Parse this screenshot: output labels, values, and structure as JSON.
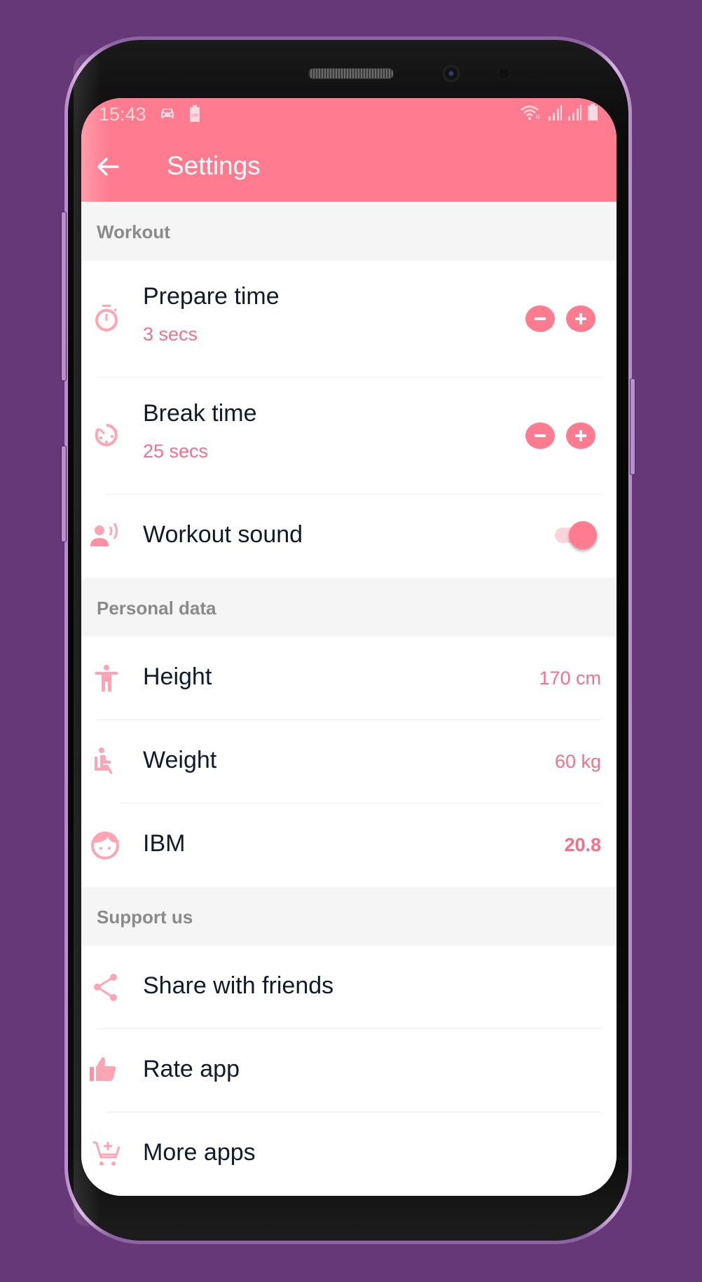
{
  "status_bar": {
    "time": "15:43",
    "left_icons": [
      "car-icon",
      "battery-100-icon"
    ],
    "right_icons": [
      "wifi-icon",
      "signal-icon",
      "signal-icon",
      "battery-icon"
    ]
  },
  "app_bar": {
    "back_icon": "arrow-left-icon",
    "title": "Settings"
  },
  "colors": {
    "accent": "#ff7b8f",
    "accent_text": "#f56f89",
    "primary_text": "#0f1b2d",
    "section_text": "#8a8a8a",
    "section_bg": "#f5f5f5",
    "background": "#663877"
  },
  "sections": [
    {
      "title": "Workout",
      "items": [
        {
          "icon": "stopwatch-icon",
          "label": "Prepare time",
          "value": "3 secs",
          "control": "stepper"
        },
        {
          "icon": "timer-icon",
          "label": "Break time",
          "value": "25 secs",
          "control": "stepper"
        },
        {
          "icon": "voice-icon",
          "label": "Workout sound",
          "control": "toggle",
          "toggle_on": true
        }
      ]
    },
    {
      "title": "Personal data",
      "items": [
        {
          "icon": "person-height-icon",
          "label": "Height",
          "value": "170 cm"
        },
        {
          "icon": "seated-person-icon",
          "label": "Weight",
          "value": "60 kg"
        },
        {
          "icon": "face-icon",
          "label": "IBM",
          "value": "20.8"
        }
      ]
    },
    {
      "title": "Support us",
      "items": [
        {
          "icon": "share-icon",
          "label": "Share with friends"
        },
        {
          "icon": "thumbs-up-icon",
          "label": "Rate app"
        },
        {
          "icon": "add-cart-icon",
          "label": "More apps"
        }
      ]
    }
  ]
}
